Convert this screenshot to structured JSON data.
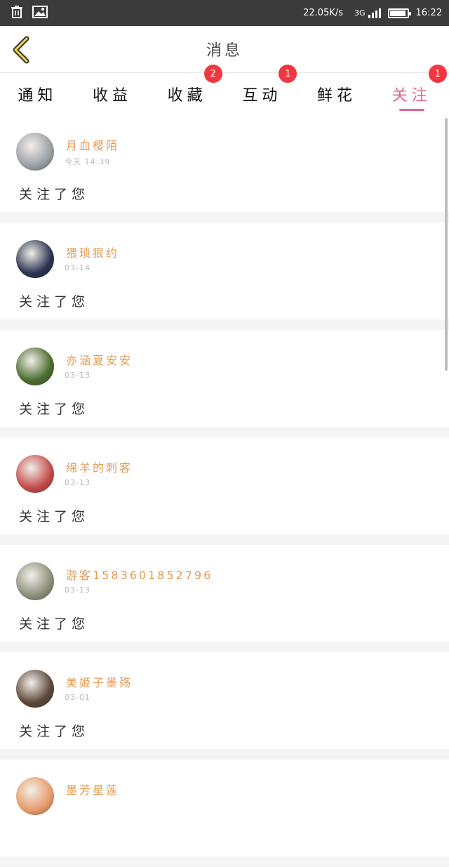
{
  "status_bar": {
    "speed": "22.05K/s",
    "network": "3G",
    "time": "16:22",
    "battery_level": 0.9,
    "icons": [
      "trash-icon",
      "image-icon"
    ]
  },
  "header": {
    "title": "消息",
    "back_icon": "chevron-left-icon"
  },
  "tabs": [
    {
      "label": "通知",
      "badge": "",
      "active": false
    },
    {
      "label": "收益",
      "badge": "",
      "active": false
    },
    {
      "label": "收藏",
      "badge": "2",
      "active": false
    },
    {
      "label": "互动",
      "badge": "1",
      "active": false
    },
    {
      "label": "鲜花",
      "badge": "",
      "active": false
    },
    {
      "label": "关注",
      "badge": "1",
      "active": true
    }
  ],
  "colors": {
    "accent": "#e0668f",
    "username": "#e69a52",
    "badge": "#f2363f"
  },
  "messages": [
    {
      "user": "月血樱陌",
      "time": "今天 14:39",
      "action": "关注了您",
      "avatar_color": "#9aa0a6"
    },
    {
      "user": "猥琐狠约",
      "time": "03-14",
      "action": "关注了您",
      "avatar_color": "#2a3350"
    },
    {
      "user": "亦涵夏安安",
      "time": "03-13",
      "action": "关注了您",
      "avatar_color": "#4a6b2d"
    },
    {
      "user": "绵羊的刺客",
      "time": "03-13",
      "action": "关注了您",
      "avatar_color": "#c24a4a"
    },
    {
      "user": "游客1583601852796",
      "time": "03-13",
      "action": "关注了您",
      "avatar_color": "#8b8f7a"
    },
    {
      "user": "美姬子墨殇",
      "time": "03-01",
      "action": "关注了您",
      "avatar_color": "#5b4638"
    },
    {
      "user": "墨芳星莲",
      "time": "",
      "action": "",
      "avatar_color": "#e79a6a"
    }
  ]
}
